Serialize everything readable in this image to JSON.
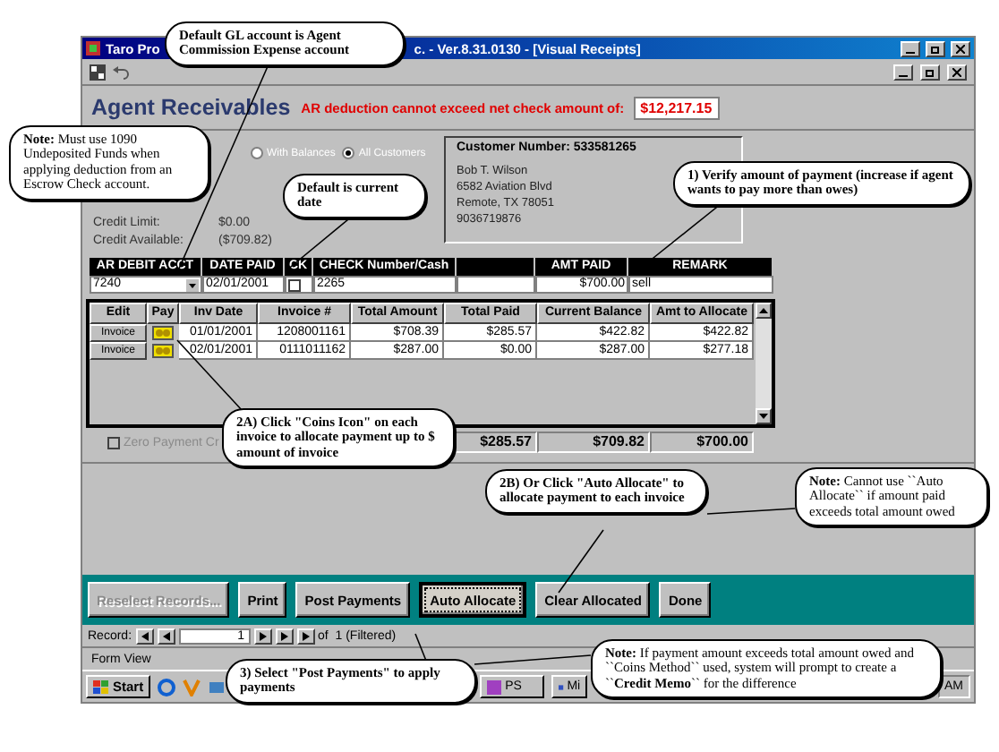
{
  "window": {
    "title_start": "Taro Pro",
    "title_end": "c. - Ver.8.31.0130 - [Visual Receipts]"
  },
  "header": {
    "title": "Agent Receivables",
    "warning": "AR deduction cannot exceed net check amount of:",
    "net_check_amount": "$12,217.15"
  },
  "filter": {
    "options": [
      {
        "label": "With Balances",
        "selected": false
      },
      {
        "label": "All Customers",
        "selected": true
      }
    ]
  },
  "credit": [
    {
      "label": "Credit Limit:",
      "value": "$0.00"
    },
    {
      "label": "Credit Available:",
      "value": "($709.82)"
    }
  ],
  "customer": {
    "number": "Customer Number: 533581265",
    "lines": [
      "Bob T. Wilson",
      "6582 Aviation Blvd",
      "Remote, TX 78051",
      "9036719876"
    ]
  },
  "payment": {
    "columns": [
      "AR DEBIT ACCT",
      "DATE PAID",
      "CK",
      "CHECK Number/Cash",
      "AMT PAID",
      "REMARK"
    ],
    "ar_debit_acct": "7240",
    "date_paid": "02/01/2001",
    "ck_checked": false,
    "check_number": "2265",
    "amt_paid": "$700.00",
    "remark": "sell"
  },
  "grid": {
    "columns": [
      "Edit",
      "Pay",
      "Inv Date",
      "Invoice #",
      "Total Amount",
      "Total Paid",
      "Current Balance",
      "Amt to Allocate"
    ],
    "rows": [
      {
        "edit": "Invoice",
        "inv_date": "01/01/2001",
        "invoice_no": "1208001161",
        "total_amount": "$708.39",
        "total_paid": "$285.57",
        "current_balance": "$422.82",
        "amt_to_allocate": "$422.82"
      },
      {
        "edit": "Invoice",
        "inv_date": "02/01/2001",
        "invoice_no": "0111011162",
        "total_amount": "$287.00",
        "total_paid": "$0.00",
        "current_balance": "$287.00",
        "amt_to_allocate": "$277.18"
      }
    ],
    "totals": {
      "total_paid": "$285.57",
      "current_balance": "$709.82",
      "amt_to_allocate": "$700.00"
    }
  },
  "zero_payment": {
    "label": "Zero Payment Cr",
    "checked": false,
    "disabled": true
  },
  "buttons": [
    {
      "label": "Reselect Records...",
      "disabled": true,
      "focused": false
    },
    {
      "label": "Print",
      "disabled": false,
      "focused": false
    },
    {
      "label": "Post Payments",
      "disabled": false,
      "focused": false
    },
    {
      "label": "Auto Allocate",
      "disabled": false,
      "focused": true
    },
    {
      "label": "Clear Allocated",
      "disabled": false,
      "focused": false
    },
    {
      "label": "Done",
      "disabled": false,
      "focused": false
    }
  ],
  "record_nav": {
    "label": "Record:",
    "current": "1",
    "total": "of  1 (Filtered)"
  },
  "status_bar": {
    "text": "Form View"
  },
  "taskbar": {
    "start": "Start",
    "tasks": [
      "PS",
      "Mi"
    ],
    "clock": "AM"
  },
  "callouts": [
    {
      "text": "Default GL account is Agent Commission Expense account"
    },
    {
      "text": "**Note:**  Must use 1090 Undeposited Funds when applying deduction from an Escrow Check account."
    },
    {
      "text": "Default is current date"
    },
    {
      "text": "1) Verify amount of payment (increase if agent wants to pay more than owes)"
    },
    {
      "text": "2A)  Click \"Coins Icon\" on each invoice to allocate payment up to $ amount of invoice"
    },
    {
      "text": "2B) Or Click \"Auto Allocate\" to allocate payment to each invoice"
    },
    {
      "text": "**Note:**  Cannot use ``Auto Allocate`` if amount paid exceeds total amount owed"
    },
    {
      "text": "3) Select \"Post Payments\" to apply payments"
    },
    {
      "text": "**Note:**  If payment amount exceeds total amount owed and ``Coins Method`` used, system will prompt to create a ``**Credit Memo**`` for the difference"
    }
  ]
}
